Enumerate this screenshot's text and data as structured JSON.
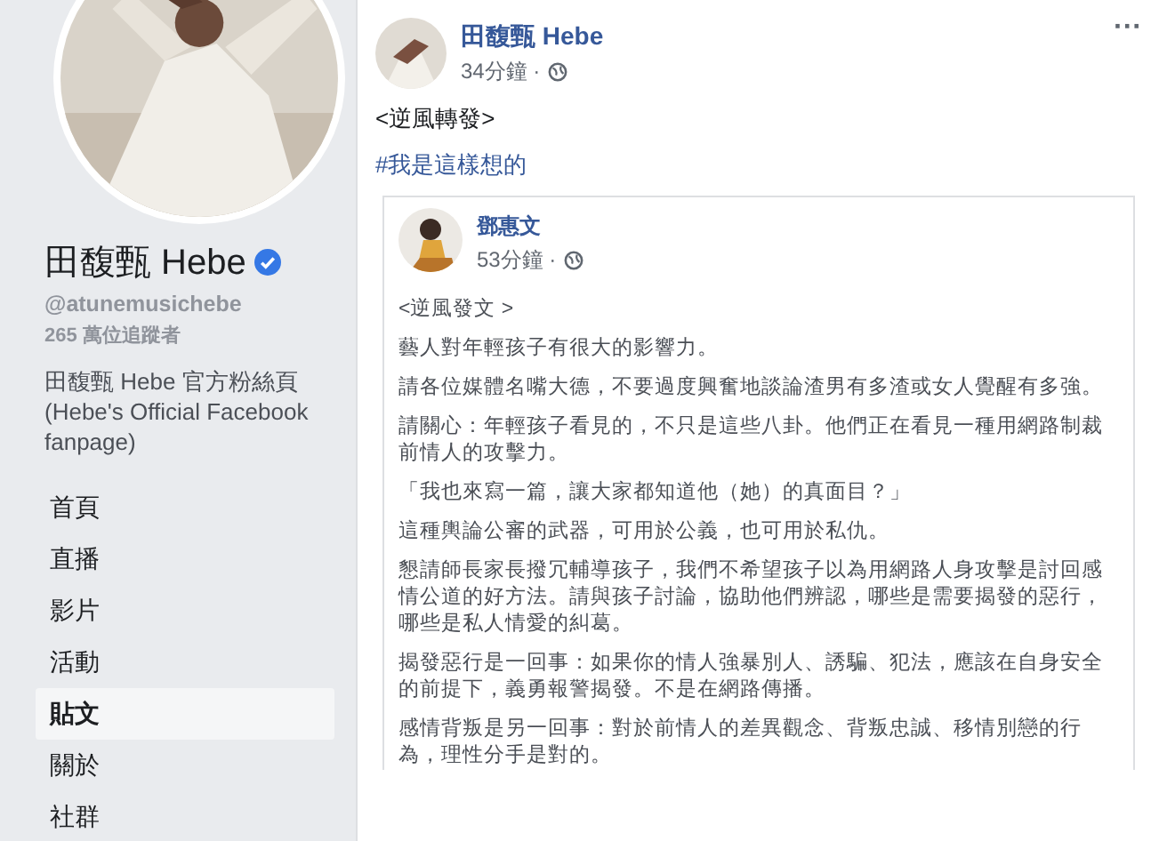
{
  "profile": {
    "name": "田馥甄 Hebe",
    "verified": true,
    "handle": "@atunemusichebe",
    "followers": "265 萬位追蹤者",
    "description": "田馥甄 Hebe 官方粉絲頁 (Hebe's Official Facebook fanpage)"
  },
  "nav": [
    {
      "label": "首頁",
      "selected": false
    },
    {
      "label": "直播",
      "selected": false
    },
    {
      "label": "影片",
      "selected": false
    },
    {
      "label": "活動",
      "selected": false
    },
    {
      "label": "貼文",
      "selected": true
    },
    {
      "label": "關於",
      "selected": false
    },
    {
      "label": "社群",
      "selected": false
    }
  ],
  "post": {
    "author": "田馥甄 Hebe",
    "time": "34分鐘 ·",
    "more": "···",
    "text": "<逆風轉發>",
    "hashtag": "#我是這樣想的",
    "shared": {
      "author": "鄧惠文",
      "time": "53分鐘 ·",
      "paragraphs": [
        "<逆風發文 >",
        "藝人對年輕孩子有很大的影響力。",
        "請各位媒體名嘴大德，不要過度興奮地談論渣男有多渣或女人覺醒有多強。",
        "請關心：年輕孩子看見的，不只是這些八卦。他們正在看見一種用網路制裁前情人的攻擊力。",
        "「我也來寫一篇，讓大家都知道他（她）的真面目？」",
        "這種輿論公審的武器，可用於公義，也可用於私仇。",
        "懇請師長家長撥冗輔導孩子，我們不希望孩子以為用網路人身攻擊是討回感情公道的好方法。請與孩子討論，協助他們辨認，哪些是需要揭發的惡行，哪些是私人情愛的糾葛。",
        "揭發惡行是一回事：如果你的情人強暴別人、誘騙、犯法，應該在自身安全的前提下，義勇報警揭發。不是在網路傳播。",
        "感情背叛是另一回事：對於前情人的差異觀念、背叛忠誠、移情別戀的行為，理性分手是對的。"
      ]
    }
  }
}
